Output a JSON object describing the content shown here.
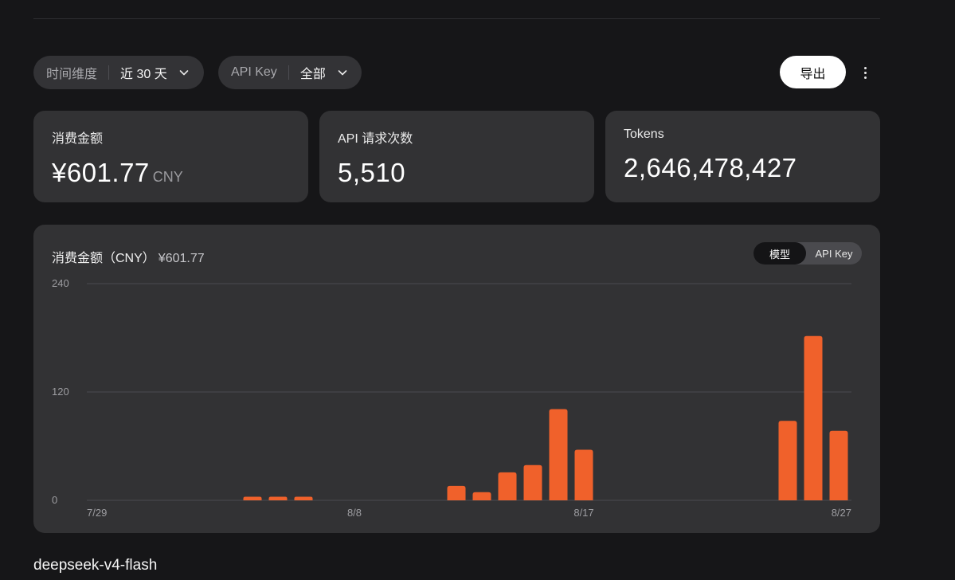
{
  "filters": {
    "time": {
      "label": "时间维度",
      "value": "近 30 天"
    },
    "api_key": {
      "label": "API Key",
      "value": "全部"
    }
  },
  "toolbar": {
    "export_label": "导出"
  },
  "stats": [
    {
      "label": "消费金额",
      "value": "¥601.77",
      "unit": "CNY"
    },
    {
      "label": "API 请求次数",
      "value": "5,510"
    },
    {
      "label": "Tokens",
      "value": "2,646,478,427"
    }
  ],
  "chart_panel": {
    "title": "消费金额（CNY）",
    "total": "¥601.77",
    "toggle": {
      "active": "模型",
      "other": "API Key"
    }
  },
  "colors": {
    "bar": "#f0612b",
    "grid": "#4b4b50",
    "axis_text": "#9d9da1"
  },
  "chart_data": {
    "type": "bar",
    "title": "消费金额（CNY）",
    "xlabel": "",
    "ylabel": "",
    "ylim": [
      0,
      240
    ],
    "yticks": [
      0,
      120,
      240
    ],
    "xtick_labels": [
      "7/29",
      "8/8",
      "8/17",
      "8/27"
    ],
    "categories": [
      "7/29",
      "7/30",
      "7/31",
      "8/1",
      "8/2",
      "8/3",
      "8/4",
      "8/5",
      "8/6",
      "8/7",
      "8/8",
      "8/9",
      "8/10",
      "8/11",
      "8/12",
      "8/13",
      "8/14",
      "8/15",
      "8/16",
      "8/17",
      "8/18",
      "8/19",
      "8/20",
      "8/21",
      "8/22",
      "8/23",
      "8/24",
      "8/25",
      "8/26",
      "8/27"
    ],
    "values": [
      0,
      0,
      0,
      0,
      0,
      0,
      4,
      4,
      4,
      0,
      0,
      0,
      0,
      0,
      16,
      9,
      31,
      39,
      101,
      56,
      0,
      0,
      0,
      0,
      0,
      0,
      0,
      88,
      182,
      77
    ],
    "grid": true
  },
  "section": {
    "model_name": "deepseek-v4-flash"
  }
}
